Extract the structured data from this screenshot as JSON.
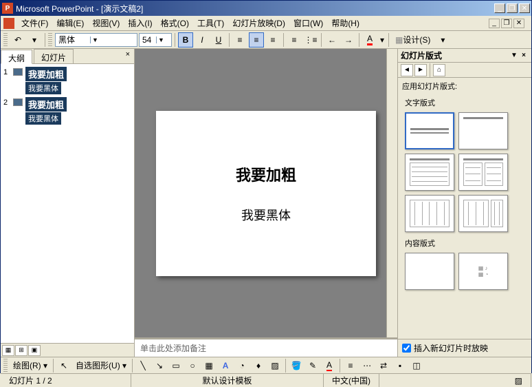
{
  "titlebar": {
    "app": "Microsoft PowerPoint",
    "doc": "[演示文稿2]"
  },
  "menubar": {
    "file": "文件(F)",
    "edit": "编辑(E)",
    "view": "视图(V)",
    "insert": "插入(I)",
    "format": "格式(O)",
    "tools": "工具(T)",
    "slideshow": "幻灯片放映(D)",
    "window": "窗口(W)",
    "help": "帮助(H)"
  },
  "toolbar": {
    "font": "黑体",
    "size": "54",
    "design": "设计(S)"
  },
  "tabs": {
    "outline": "大纲",
    "slides": "幻灯片"
  },
  "outline": {
    "slides": [
      {
        "num": "1",
        "title": "我要加粗",
        "subtitle": "我要黑体"
      },
      {
        "num": "2",
        "title": "我要加粗",
        "subtitle": "我要黑体"
      }
    ]
  },
  "slide": {
    "title": "我要加粗",
    "subtitle": "我要黑体"
  },
  "notes": {
    "placeholder": "单击此处添加备注"
  },
  "taskpane": {
    "title": "幻灯片版式",
    "apply_label": "应用幻灯片版式:",
    "text_layouts": "文字版式",
    "content_layouts": "内容版式",
    "footer_checkbox": "插入新幻灯片时放映"
  },
  "draw": {
    "label": "绘图(R)",
    "autoshapes": "自选图形(U)"
  },
  "status": {
    "slide": "幻灯片 1 / 2",
    "template": "默认设计模板",
    "lang": "中文(中国)"
  }
}
